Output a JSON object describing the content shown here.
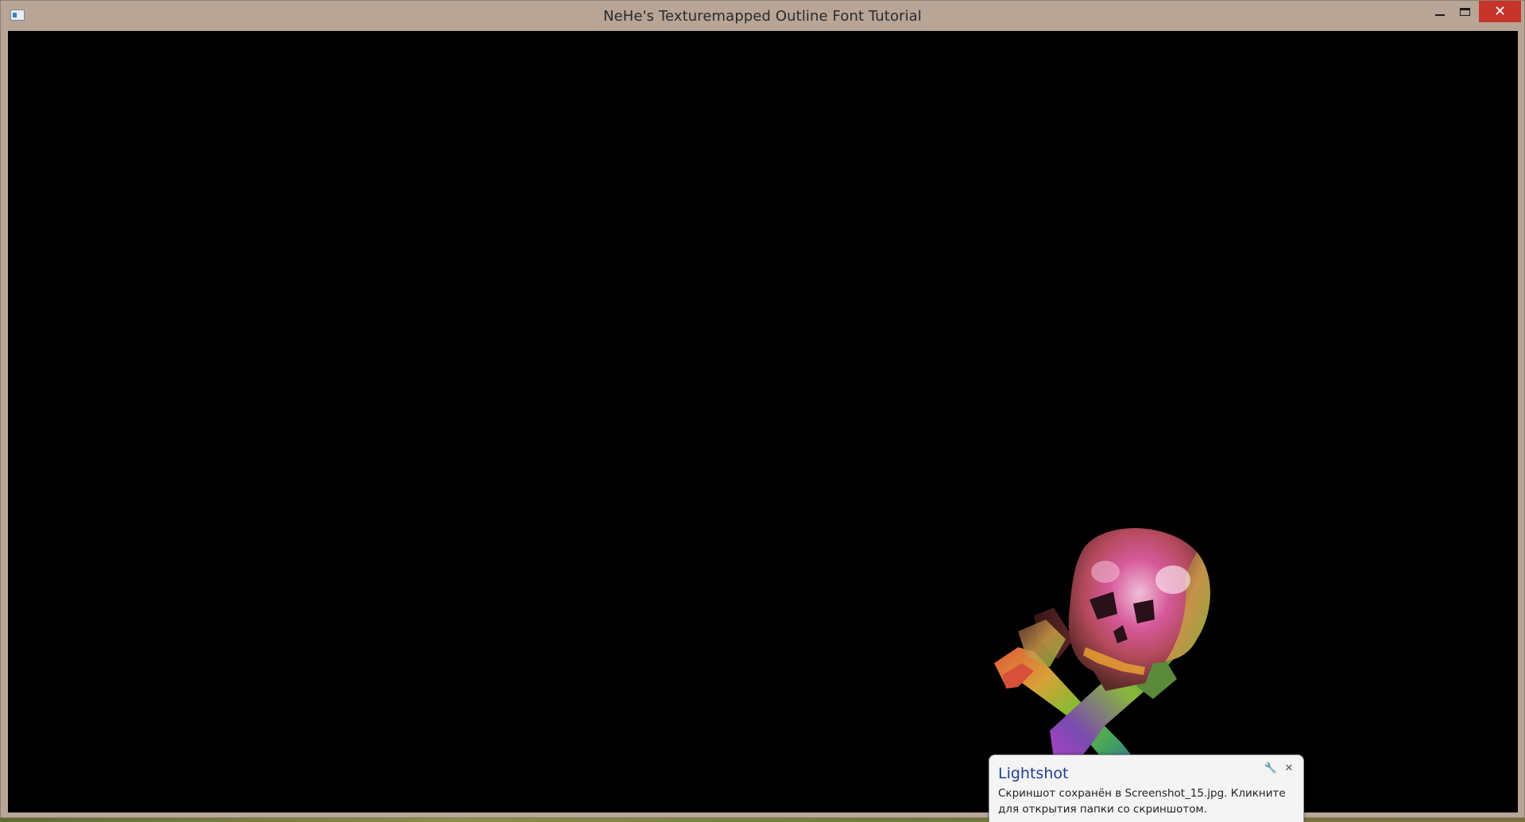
{
  "window": {
    "title": "NeHe's Texturemapped Outline Font Tutorial",
    "icon": "app-window-icon",
    "controls": {
      "minimize_icon": "minimize-icon",
      "maximize_icon": "maximize-icon",
      "close_glyph": "✕"
    },
    "frame_color": "#b8a596",
    "close_color": "#c7342b"
  },
  "viewport": {
    "background": "#000000",
    "object": "skull-and-crossbones-3d"
  },
  "notification": {
    "app": "Lightshot",
    "message": "Скриншот сохранён в Screenshot_15.jpg. Кликните для открытия папки со скриншотом.",
    "settings_icon": "🔧",
    "close_icon": "✕",
    "title_color": "#1f3f8f"
  }
}
